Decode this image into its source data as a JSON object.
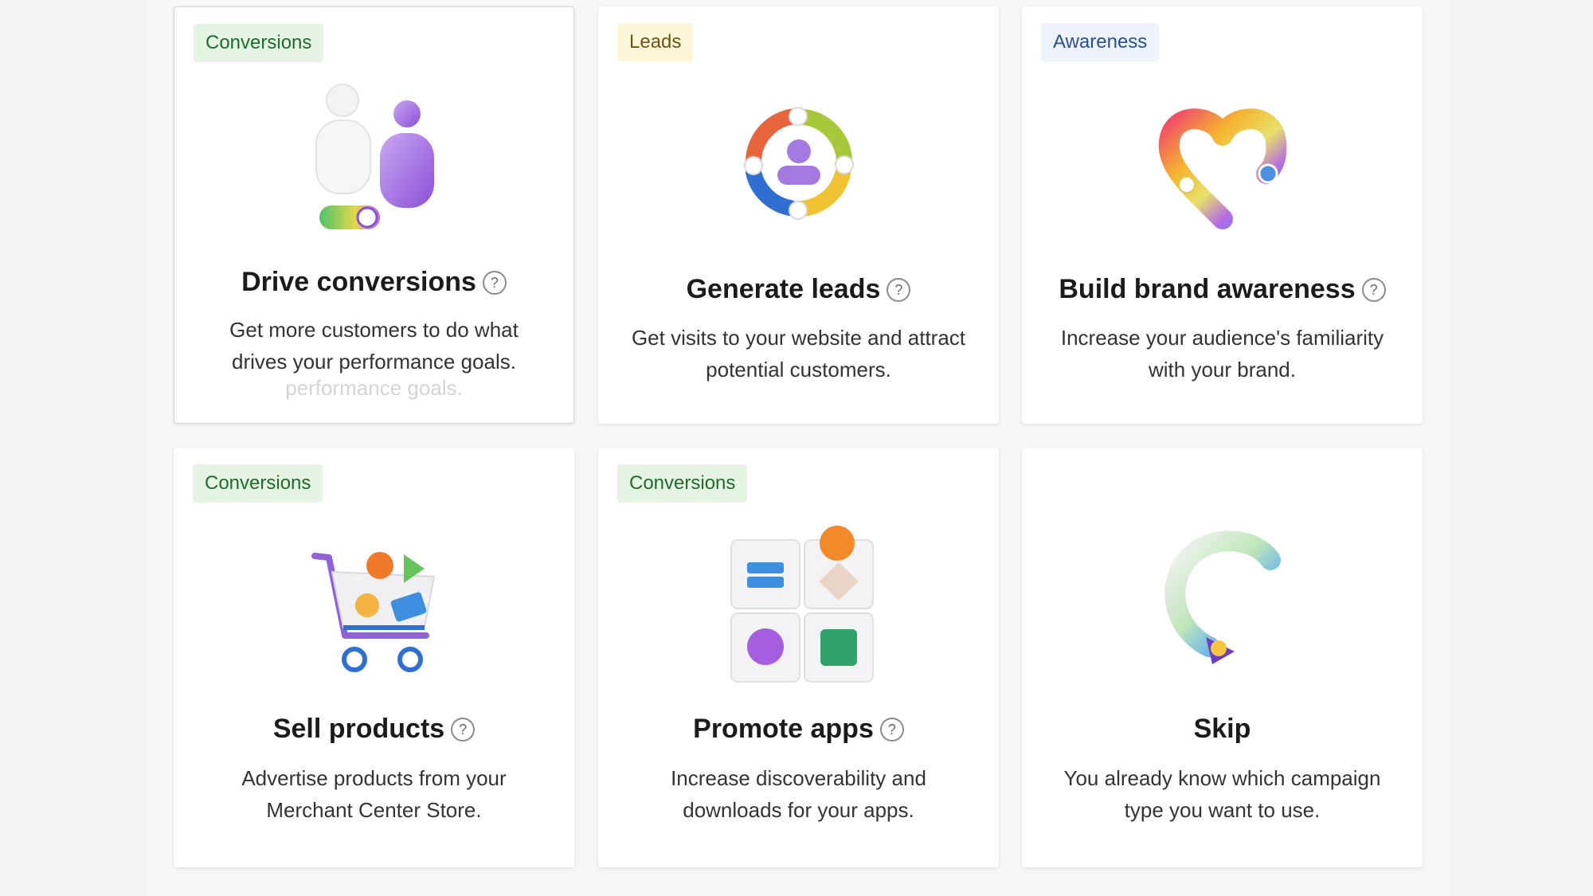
{
  "cards": [
    {
      "tag": "Conversions",
      "title": "Drive conversions",
      "description": "Get more customers to do what drives your performance goals.",
      "ghost_text": "performance goals.",
      "help_icon": "?",
      "icon": "people-toggle-icon"
    },
    {
      "tag": "Leads",
      "title": "Generate leads",
      "description": "Get visits to your website and attract potential customers.",
      "help_icon": "?",
      "icon": "person-cycle-icon"
    },
    {
      "tag": "Awareness",
      "title": "Build brand awareness",
      "description": "Increase your audience's familiarity with your brand.",
      "help_icon": "?",
      "icon": "heart-icon"
    },
    {
      "tag": "Conversions",
      "title": "Sell products",
      "description": "Advertise products from your Merchant Center Store.",
      "help_icon": "?",
      "icon": "shopping-cart-icon"
    },
    {
      "tag": "Conversions",
      "title": "Promote apps",
      "description": "Increase discoverability and downloads for your apps.",
      "help_icon": "?",
      "icon": "app-grid-icon"
    },
    {
      "title": "Skip",
      "description": "You already know which campaign type you want to use.",
      "icon": "arrow-loop-icon"
    }
  ],
  "colors": {
    "conversions_tag_bg": "#e5f4e3",
    "leads_tag_bg": "#fdf6d8",
    "awareness_tag_bg": "#eef3fb"
  }
}
